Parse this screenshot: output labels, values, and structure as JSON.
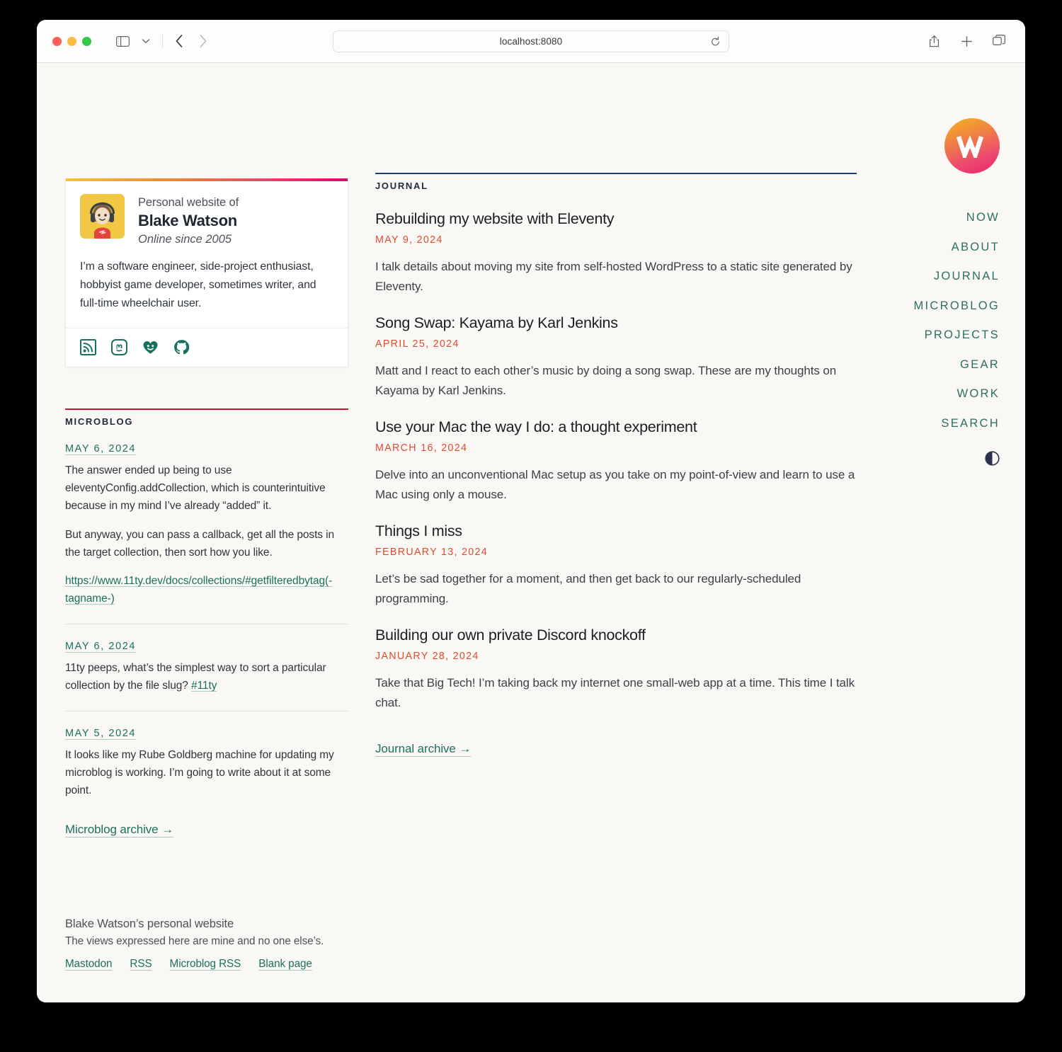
{
  "browser": {
    "url": "localhost:8080",
    "traffic_lights": [
      "close",
      "minimize",
      "maximize"
    ],
    "icons": {
      "sidebar": "sidebar-icon",
      "chevron_down": "chevron-down-icon",
      "back": "back-arrow-icon",
      "forward": "forward-arrow-icon",
      "reload": "reload-icon",
      "share": "share-icon",
      "new_tab": "plus-icon",
      "tab_overview": "tab-overview-icon"
    }
  },
  "profile": {
    "eyebrow": "Personal website of",
    "name": "Blake Watson",
    "tagline": "Online since 2005",
    "bio": "I’m a software engineer, side-project enthusiast, hobbyist game developer, sometimes writer, and full-time wheelchair user.",
    "socials": [
      {
        "name": "rss-icon",
        "label": "RSS"
      },
      {
        "name": "mastodon-icon",
        "label": "Mastodon"
      },
      {
        "name": "neocities-icon",
        "label": "Neocities"
      },
      {
        "name": "github-icon",
        "label": "GitHub"
      }
    ]
  },
  "microblog": {
    "section_title": "MICROBLOG",
    "entries": [
      {
        "date": "MAY 6, 2024",
        "paragraphs": [
          "The answer ended up being to use eleventyConfig.addCollection, which is counterintuitive because in my mind I’ve already “added” it.",
          "But anyway, you can pass a callback, get all the posts in the target collection, then sort how you like."
        ],
        "link": "https://www.11ty.dev/docs/collections/#getfilteredbytag(-tagname-)"
      },
      {
        "date": "MAY 6, 2024",
        "text_before_tag": "11ty peeps, what’s the simplest way to sort a particular collection by the file slug? ",
        "tag": "#11ty"
      },
      {
        "date": "MAY 5, 2024",
        "paragraphs": [
          "It looks like my Rube Goldberg machine for updating my microblog is working. I’m going to write about it at some point."
        ]
      }
    ],
    "archive_label": "Microblog archive →"
  },
  "journal": {
    "section_title": "JOURNAL",
    "entries": [
      {
        "title": "Rebuilding my website with Eleventy",
        "date": "MAY 9, 2024",
        "description": "I talk details about moving my site from self-hosted WordPress to a static site generated by Eleventy."
      },
      {
        "title": "Song Swap: Kayama by Karl Jenkins",
        "date": "APRIL 25, 2024",
        "description": "Matt and I react to each other’s music by doing a song swap. These are my thoughts on Kayama by Karl Jenkins."
      },
      {
        "title": "Use your Mac the way I do: a thought experiment",
        "date": "MARCH 16, 2024",
        "description": "Delve into an unconventional Mac setup as you take on my point-of-view and learn to use a Mac using only a mouse."
      },
      {
        "title": "Things I miss",
        "date": "FEBRUARY 13, 2024",
        "description": "Let’s be sad together for a moment, and then get back to our regularly-scheduled programming."
      },
      {
        "title": "Building our own private Discord knockoff",
        "date": "JANUARY 28, 2024",
        "description": "Take that Big Tech! I’m taking back my internet one small-web app at a time. This time I talk chat."
      }
    ],
    "archive_label": "Journal archive →"
  },
  "nav": {
    "logo_letter": "W",
    "items": [
      {
        "label": "NOW"
      },
      {
        "label": "ABOUT"
      },
      {
        "label": "JOURNAL"
      },
      {
        "label": "MICROBLOG"
      },
      {
        "label": "PROJECTS"
      },
      {
        "label": "GEAR"
      },
      {
        "label": "WORK"
      },
      {
        "label": "SEARCH"
      }
    ],
    "theme_toggle": "contrast-icon"
  },
  "footer": {
    "line1": "Blake Watson’s personal website",
    "line2": "The views expressed here are mine and no one else’s.",
    "links": [
      {
        "label": "Mastodon"
      },
      {
        "label": "RSS"
      },
      {
        "label": "Microblog RSS"
      },
      {
        "label": "Blank page"
      }
    ]
  },
  "colors": {
    "page_bg": "#f9f8f4",
    "link_teal": "#1d6f60",
    "journal_date_red": "#e04b32",
    "microblog_border": "#c4142f",
    "journal_border": "#1f3b7a"
  }
}
